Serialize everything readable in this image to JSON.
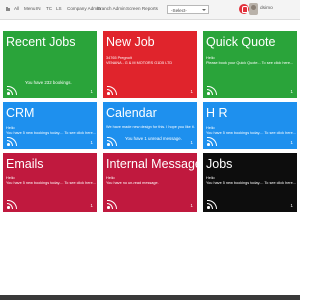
{
  "nav": {
    "items": [
      "All",
      "Menu",
      "IN",
      "TC",
      "LS",
      "Company Admin",
      "Branch Admin",
      "Screen Reports"
    ],
    "select_value": "-Select-",
    "user_name": "dsimo"
  },
  "tiles": [
    {
      "title": "Recent Jobs",
      "lines": [],
      "middle": "You have 232 bookings.",
      "count": "1"
    },
    {
      "title": "New Job",
      "lines": [
        "34765 Pregnolt",
        "VENANA - G & M MOTORS G1D5 LTD"
      ],
      "middle": "",
      "count": "1"
    },
    {
      "title": "Quick Quote",
      "lines": [
        "Hello",
        "Please book your Quick Quote... To see click here..."
      ],
      "middle": "",
      "count": "1"
    },
    {
      "title": "CRM",
      "lines": [
        "Hello",
        "You have 5 new bookings today.... To see click here..."
      ],
      "middle": "",
      "count": "1"
    },
    {
      "title": "Calendar",
      "lines": [
        "We have made new design for this. I hope you like it."
      ],
      "middle": "You have 1 unread message.",
      "count": "1"
    },
    {
      "title": "H R",
      "lines": [
        "Hello",
        "You have 5 new bookings today.... To see click here..."
      ],
      "middle": "",
      "count": "1"
    },
    {
      "title": "Emails",
      "lines": [
        "Hello",
        "You have 5 new bookings today.... To see click here..."
      ],
      "middle": "",
      "count": "1"
    },
    {
      "title": "Internal Message",
      "lines": [
        "Hello",
        "You have no un-read message."
      ],
      "middle": "",
      "count": "1"
    },
    {
      "title": "Jobs",
      "lines": [
        "Hello",
        "You have 5 new bookings today.... To see click here..."
      ],
      "middle": "",
      "count": "1"
    }
  ],
  "colors": {
    "green": "#2aa43a",
    "red": "#e0242c",
    "blue": "#1e90ee",
    "crimson": "#c0193e",
    "black": "#0d0d0d"
  },
  "icons": {
    "tile_feed": "rss-icon",
    "notifications": "bell-icon"
  }
}
